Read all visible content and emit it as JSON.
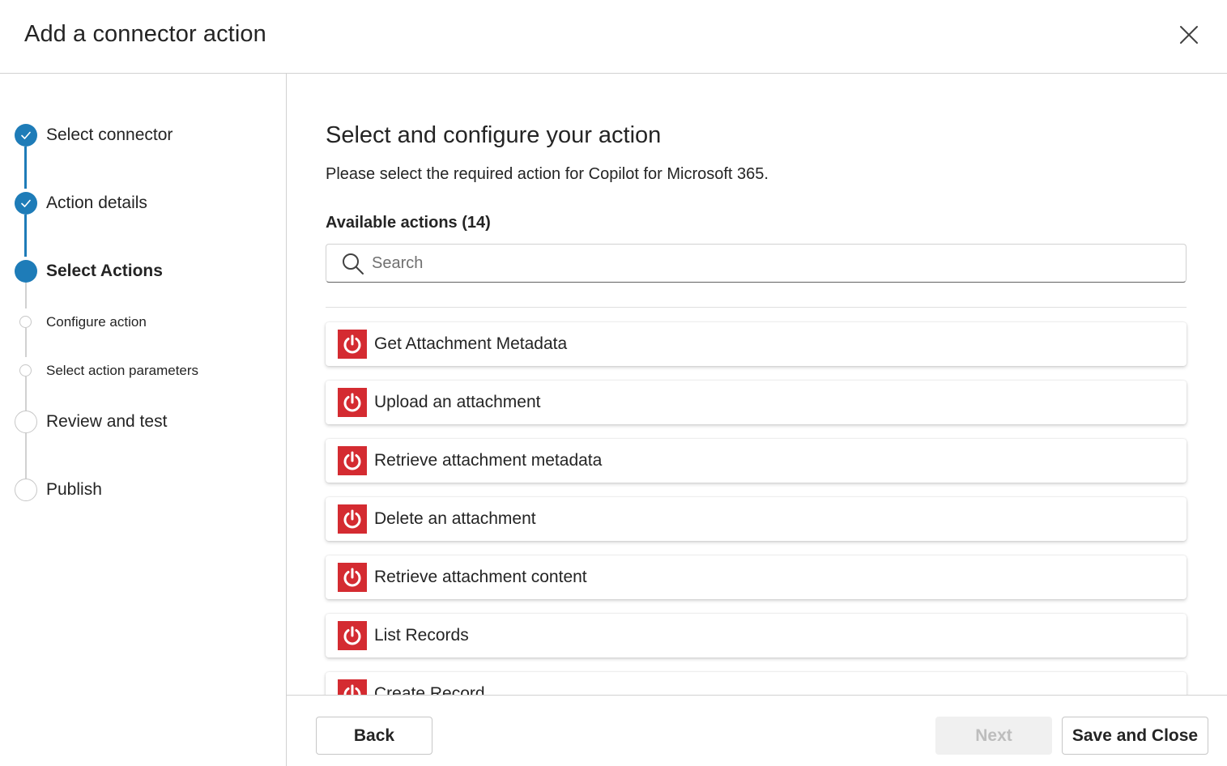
{
  "dialog": {
    "title": "Add a connector action",
    "close_icon": "close-icon"
  },
  "steps": [
    {
      "label": "Select connector",
      "status": "completed"
    },
    {
      "label": "Action details",
      "status": "completed"
    },
    {
      "label": "Select Actions",
      "status": "current"
    },
    {
      "label": "Configure action",
      "status": "pending-substep"
    },
    {
      "label": "Select action parameters",
      "status": "pending-substep"
    },
    {
      "label": "Review and test",
      "status": "pending"
    },
    {
      "label": "Publish",
      "status": "pending"
    }
  ],
  "main": {
    "title": "Select and configure your action",
    "description": "Please select the required action for Copilot for Microsoft 365.",
    "available_label": "Available actions (14)",
    "search": {
      "placeholder": "Search",
      "value": ""
    },
    "actions": [
      {
        "label": "Get Attachment Metadata",
        "icon": "power-icon"
      },
      {
        "label": "Upload an attachment",
        "icon": "power-icon"
      },
      {
        "label": "Retrieve attachment metadata",
        "icon": "power-icon"
      },
      {
        "label": "Delete an attachment",
        "icon": "power-icon"
      },
      {
        "label": "Retrieve attachment content",
        "icon": "power-icon"
      },
      {
        "label": "List Records",
        "icon": "power-icon"
      },
      {
        "label": "Create Record",
        "icon": "power-icon"
      }
    ]
  },
  "footer": {
    "back_label": "Back",
    "next_label": "Next",
    "save_close_label": "Save and Close"
  },
  "colors": {
    "accent": "#1e7cb8",
    "connector_icon_bg": "#d42b31",
    "disabled_text": "#bdbdbd"
  }
}
